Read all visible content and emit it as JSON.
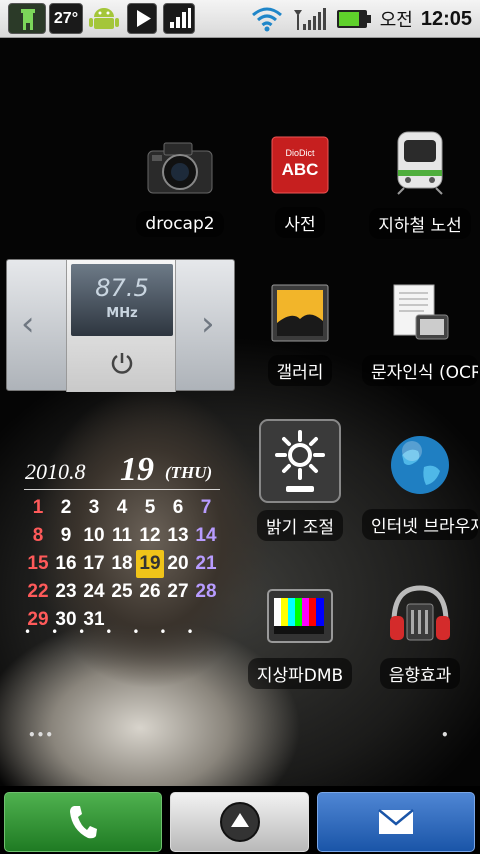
{
  "status_bar": {
    "temperature": "27°",
    "ampm": "오전",
    "time": "12:05",
    "icons": [
      "launcher-tower-icon",
      "android-icon",
      "media-play-icon",
      "signal-bars-icon",
      "wifi-icon",
      "cell-signal-icon",
      "battery-icon"
    ]
  },
  "radio_widget": {
    "frequency": "87.5",
    "unit": "MHz",
    "prev_symbol": "‹",
    "next_symbol": "›"
  },
  "calendar": {
    "year_month": "2010.8",
    "day": "19",
    "weekday": "(THU)",
    "today": 19,
    "weeks": [
      [
        1,
        2,
        3,
        4,
        5,
        6,
        7
      ],
      [
        8,
        9,
        10,
        11,
        12,
        13,
        14
      ],
      [
        15,
        16,
        17,
        18,
        19,
        20,
        21
      ],
      [
        22,
        23,
        24,
        25,
        26,
        27,
        28
      ],
      [
        29,
        30,
        31
      ]
    ]
  },
  "apps": {
    "drocap2": "drocap2",
    "dictionary": "사전",
    "subway": "지하철 노선",
    "gallery": "갤러리",
    "ocr": "문자인식 (OCR)",
    "brightness": "밝기 조절",
    "internet": "인터넷 브라우저",
    "dmb": "지상파DMB",
    "sound_effects": "음향효과"
  },
  "dictionary_icon_text": {
    "brand": "DioDict",
    "abc": "ABC"
  },
  "page_indicator_left": "•••",
  "page_indicator_right": "•"
}
